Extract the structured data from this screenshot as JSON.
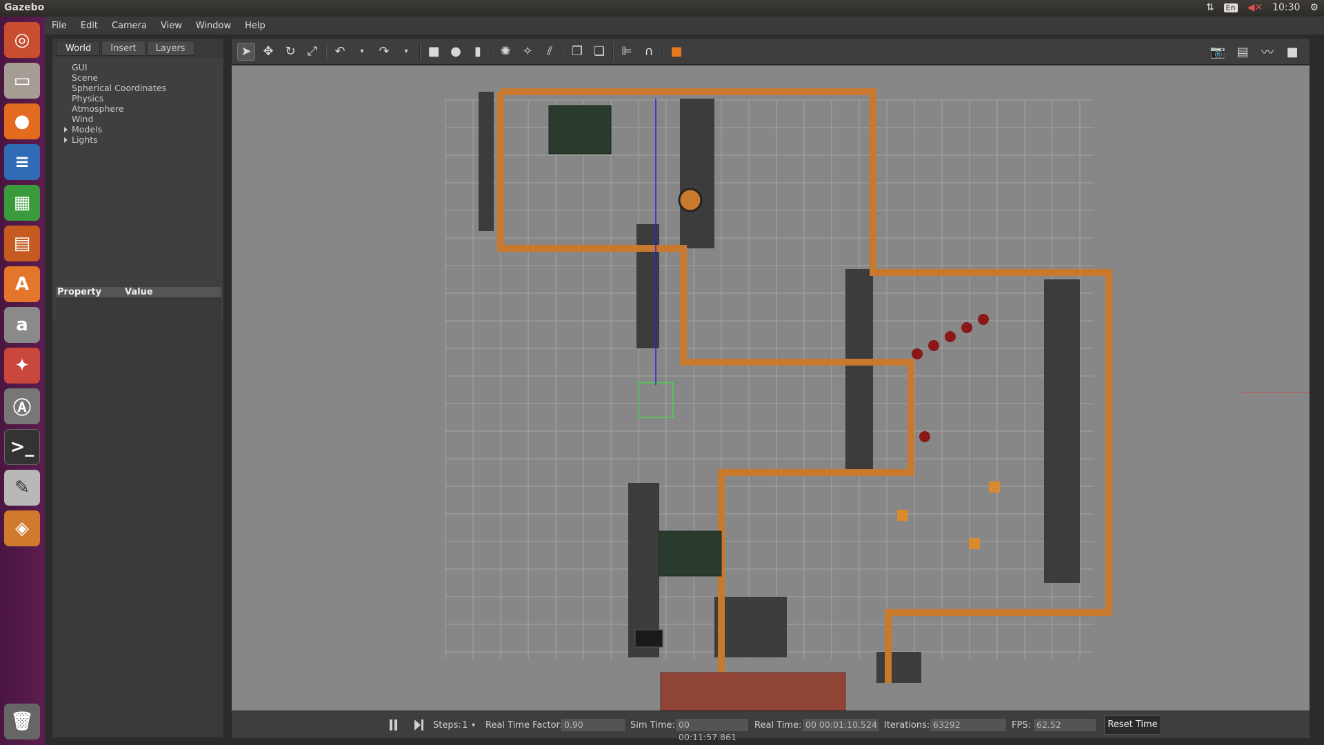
{
  "topbar": {
    "app_title": "Gazebo",
    "lang": "En",
    "time": "10:30",
    "icons": [
      "network-icon",
      "keyboard-lang-icon",
      "volume-muted-icon",
      "clock",
      "settings-gear-icon"
    ]
  },
  "launcher": {
    "items": [
      {
        "name": "ubuntu-dash-icon",
        "color": "#c94d2f"
      },
      {
        "name": "files-icon",
        "color": "#a59d94"
      },
      {
        "name": "firefox-icon",
        "color": "#e36b1f"
      },
      {
        "name": "writer-icon",
        "color": "#2f6cb5"
      },
      {
        "name": "calc-icon",
        "color": "#3a9b3c"
      },
      {
        "name": "impress-icon",
        "color": "#c55b21"
      },
      {
        "name": "software-center-icon",
        "color": "#e4762c"
      },
      {
        "name": "amazon-icon",
        "color": "#8a8a8a"
      },
      {
        "name": "system-settings-icon",
        "color": "#c9473c"
      },
      {
        "name": "software-updater-icon",
        "color": "#777777"
      },
      {
        "name": "terminal-icon",
        "color": "#333333"
      },
      {
        "name": "text-editor-icon",
        "color": "#b8b8b8"
      },
      {
        "name": "gazebo-icon",
        "color": "#d07a2e"
      }
    ],
    "trash": {
      "name": "trash-icon",
      "color": "#888"
    }
  },
  "menu": [
    "File",
    "Edit",
    "Camera",
    "View",
    "Window",
    "Help"
  ],
  "left_panel": {
    "tabs": [
      "World",
      "Insert",
      "Layers"
    ],
    "tree": [
      "GUI",
      "Scene",
      "Spherical Coordinates",
      "Physics",
      "Atmosphere",
      "Wind",
      "Models",
      "Lights"
    ],
    "property_header": "Property",
    "value_header": "Value"
  },
  "bottom": {
    "steps_label": "Steps:",
    "steps_value": "1",
    "rtf_label": "Real Time Factor:",
    "rtf_value": "0.90",
    "sim_label": "Sim Time:",
    "sim_value": "00 00:11:57.861",
    "real_label": "Real Time:",
    "real_value": "00 00:01:10.524",
    "iter_label": "Iterations:",
    "iter_value": "63292",
    "fps_label": "FPS:",
    "fps_value": "62.52",
    "reset_label": "Reset Time"
  },
  "colors": {
    "wall": "#c8792e",
    "shadow": "#3c3c3c",
    "ground": "#878787",
    "grid": "#a8a8a8"
  }
}
